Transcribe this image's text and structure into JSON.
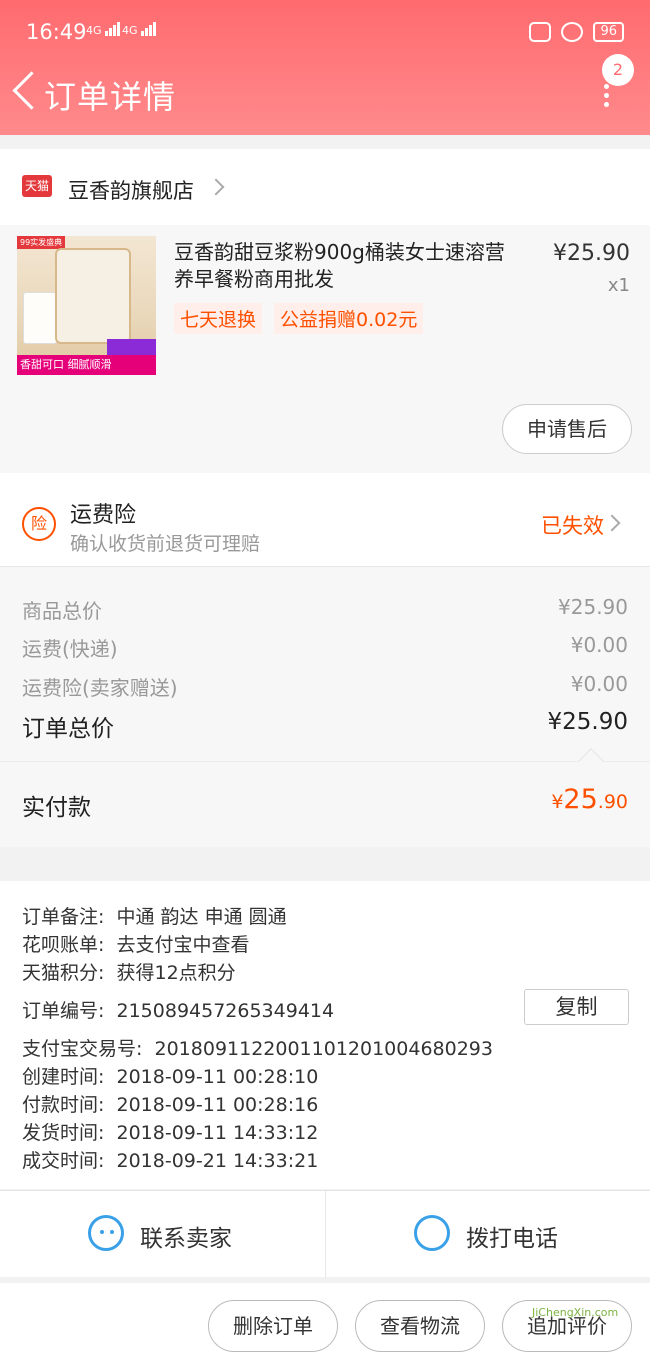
{
  "status_bar": {
    "time": "16:49",
    "network1": "4G",
    "network2": "4G",
    "battery": "96"
  },
  "header": {
    "title": "订单详情",
    "badge_count": "2"
  },
  "store": {
    "logo_text": "天猫",
    "name": "豆香韵旗舰店"
  },
  "product": {
    "title": "豆香韵甜豆浆粉900g桶装女士速溶营养早餐粉商用批发",
    "price": "¥25.90",
    "quantity": "x1",
    "tags": [
      "七天退换",
      "公益捐赠0.02元"
    ],
    "thumb_tag": "99实发盛典",
    "thumb_slogan": "香甜可口 细腻顺滑",
    "after_sale_label": "申请售后"
  },
  "insurance": {
    "icon_text": "险",
    "title": "运费险",
    "subtitle": "确认收货前退货可理赔",
    "status": "已失效"
  },
  "fees": {
    "items_label": "商品总价",
    "items_value": "¥25.90",
    "shipping_label": "运费(快递)",
    "shipping_value": "¥0.00",
    "insurance_label": "运费险(卖家赠送)",
    "insurance_value": "¥0.00",
    "total_label": "订单总价",
    "total_value": "¥25.90"
  },
  "paid": {
    "label": "实付款",
    "currency": "¥",
    "integer": "25",
    "decimal": ".90"
  },
  "info": {
    "remark_label": "订单备注:",
    "remark_value": "中通 韵达 申通 圆通",
    "huabei_label": "花呗账单:",
    "huabei_value": "去支付宝中查看",
    "points_label": "天猫积分:",
    "points_value": "获得12点积分",
    "order_no_label": "订单编号:",
    "order_no_value": "215089457265349414",
    "copy_label": "复制",
    "alipay_label": "支付宝交易号:",
    "alipay_value": "2018091122001101201004680293",
    "created_label": "创建时间:",
    "created_value": "2018-09-11 00:28:10",
    "paid_label": "付款时间:",
    "paid_value": "2018-09-11 00:28:16",
    "shipped_label": "发货时间:",
    "shipped_value": "2018-09-11 14:33:12",
    "done_label": "成交时间:",
    "done_value": "2018-09-21 14:33:21"
  },
  "contact": {
    "seller_label": "联系卖家",
    "phone_label": "拨打电话"
  },
  "actions": {
    "delete_label": "删除订单",
    "logistics_label": "查看物流",
    "review_label": "追加评价"
  },
  "watermark": "JiChengXin.com"
}
